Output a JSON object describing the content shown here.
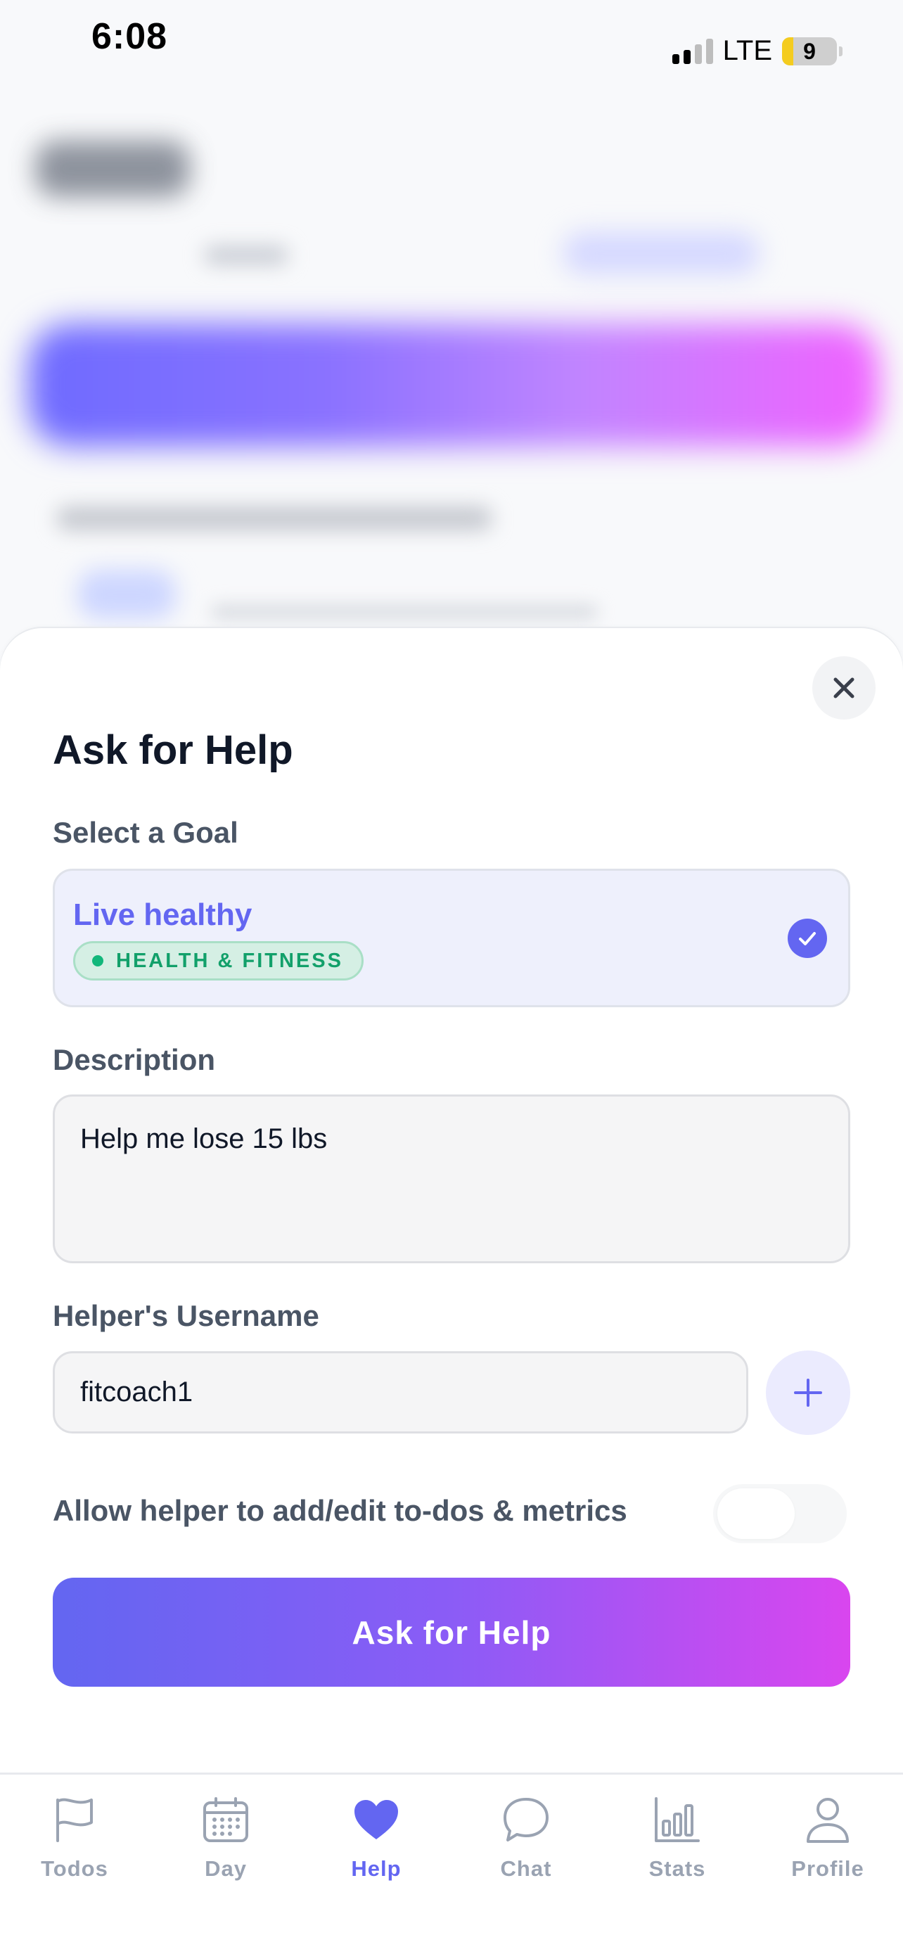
{
  "status_bar": {
    "time": "6:08",
    "network": "LTE",
    "battery": "9"
  },
  "sheet": {
    "title": "Ask for Help",
    "goal_label": "Select a Goal",
    "goal": {
      "name": "Live healthy",
      "category": "HEALTH & FITNESS",
      "selected": true
    },
    "description_label": "Description",
    "description_value": "Help me lose 15 lbs",
    "helper_label": "Helper's Username",
    "helper_value": "fitcoach1",
    "permission_label": "Allow helper to add/edit to-dos & metrics",
    "permission_enabled": false,
    "submit_label": "Ask for Help"
  },
  "tabs": [
    {
      "label": "Todos",
      "icon": "flag-icon",
      "active": false
    },
    {
      "label": "Day",
      "icon": "calendar-icon",
      "active": false
    },
    {
      "label": "Help",
      "icon": "heart-icon",
      "active": true
    },
    {
      "label": "Chat",
      "icon": "chat-bubble-icon",
      "active": false
    },
    {
      "label": "Stats",
      "icon": "bar-chart-icon",
      "active": false
    },
    {
      "label": "Profile",
      "icon": "person-icon",
      "active": false
    }
  ],
  "colors": {
    "accent": "#6366f1",
    "gradient_start": "#6366f1",
    "gradient_end": "#d946ef",
    "category_green": "#12a06a",
    "inactive_tab": "#9aa3b2"
  }
}
